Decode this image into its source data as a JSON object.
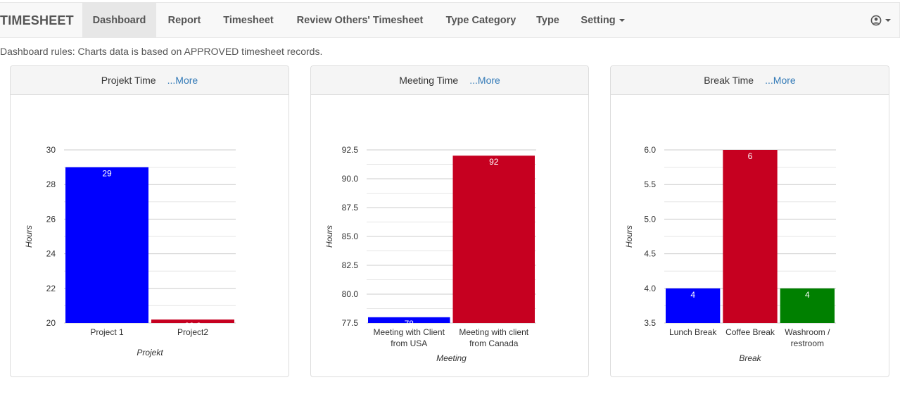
{
  "nav": {
    "brand": "TIMESHEET",
    "items": [
      {
        "label": "Dashboard"
      },
      {
        "label": "Report"
      },
      {
        "label": "Timesheet"
      },
      {
        "label": "Review Others' Timesheet"
      },
      {
        "label": "Type Category"
      },
      {
        "label": "Type"
      },
      {
        "label": "Setting"
      }
    ],
    "active_index": 0,
    "user_icon": "user-circle-icon"
  },
  "rules_text": "Dashboard rules: Charts data is based on APPROVED timesheet records.",
  "panels": [
    {
      "title": "Projekt Time",
      "more": "...More"
    },
    {
      "title": "Meeting Time",
      "more": "...More"
    },
    {
      "title": "Break Time",
      "more": "...More"
    }
  ],
  "chart_data": [
    {
      "type": "bar",
      "title": "",
      "xlabel": "Projekt",
      "ylabel": "Hours",
      "ylim": [
        20,
        30
      ],
      "yticks": [
        "20",
        "22",
        "24",
        "26",
        "28",
        "30"
      ],
      "grid": true,
      "categories": [
        [
          "Project 1"
        ],
        [
          "Project2"
        ]
      ],
      "values": [
        29,
        20.2
      ],
      "labels": [
        "29",
        "20.2"
      ],
      "colors": [
        "#0000ff",
        "#c60020"
      ]
    },
    {
      "type": "bar",
      "title": "",
      "xlabel": "Meeting",
      "ylabel": "Hours",
      "ylim": [
        77.5,
        92.5
      ],
      "yticks": [
        "77.5",
        "80.0",
        "82.5",
        "85.0",
        "87.5",
        "90.0",
        "92.5"
      ],
      "grid": true,
      "categories": [
        [
          "Meeting with Client",
          "from USA"
        ],
        [
          "Meeting with client",
          "from Canada"
        ]
      ],
      "values": [
        78,
        92
      ],
      "labels": [
        "78",
        "92"
      ],
      "colors": [
        "#0000ff",
        "#c60020"
      ]
    },
    {
      "type": "bar",
      "title": "",
      "xlabel": "Break",
      "ylabel": "Hours",
      "ylim": [
        3.5,
        6.0
      ],
      "yticks": [
        "3.5",
        "4.0",
        "4.5",
        "5.0",
        "5.5",
        "6.0"
      ],
      "grid": true,
      "categories": [
        [
          "Lunch Break"
        ],
        [
          "Coffee Break"
        ],
        [
          "Washroom /",
          "restroom"
        ]
      ],
      "values": [
        4,
        6,
        4
      ],
      "labels": [
        "4",
        "6",
        "4"
      ],
      "colors": [
        "#0000ff",
        "#c60020",
        "#008000"
      ]
    }
  ]
}
